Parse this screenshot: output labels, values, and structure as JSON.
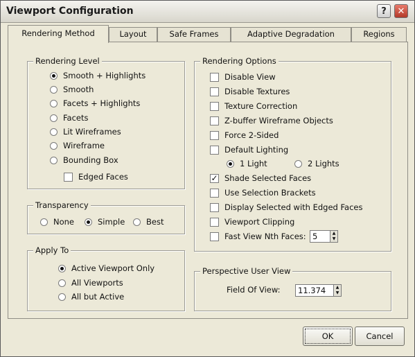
{
  "window": {
    "title": "Viewport Configuration",
    "help_label": "?",
    "close_label": "✕"
  },
  "tabs": [
    {
      "label": "Rendering Method"
    },
    {
      "label": "Layout"
    },
    {
      "label": "Safe Frames"
    },
    {
      "label": "Adaptive Degradation"
    },
    {
      "label": "Regions"
    }
  ],
  "rendering_level": {
    "legend": "Rendering Level",
    "options": [
      {
        "label": "Smooth + Highlights",
        "selected": true
      },
      {
        "label": "Smooth",
        "selected": false
      },
      {
        "label": "Facets + Highlights",
        "selected": false
      },
      {
        "label": "Facets",
        "selected": false
      },
      {
        "label": "Lit Wireframes",
        "selected": false
      },
      {
        "label": "Wireframe",
        "selected": false
      },
      {
        "label": "Bounding Box",
        "selected": false
      }
    ],
    "edged_faces": {
      "label": "Edged Faces",
      "checked": false
    }
  },
  "transparency": {
    "legend": "Transparency",
    "options": [
      {
        "label": "None",
        "selected": false
      },
      {
        "label": "Simple",
        "selected": true
      },
      {
        "label": "Best",
        "selected": false
      }
    ]
  },
  "apply_to": {
    "legend": "Apply To",
    "options": [
      {
        "label": "Active Viewport Only",
        "selected": true
      },
      {
        "label": "All Viewports",
        "selected": false
      },
      {
        "label": "All but Active",
        "selected": false
      }
    ]
  },
  "rendering_options": {
    "legend": "Rendering Options",
    "checks": [
      {
        "label": "Disable View",
        "checked": false
      },
      {
        "label": "Disable Textures",
        "checked": false
      },
      {
        "label": "Texture Correction",
        "checked": false
      },
      {
        "label": "Z-buffer Wireframe Objects",
        "checked": false
      },
      {
        "label": "Force 2-Sided",
        "checked": false
      },
      {
        "label": "Default Lighting",
        "checked": false
      }
    ],
    "lights": [
      {
        "label": "1 Light",
        "selected": true
      },
      {
        "label": "2 Lights",
        "selected": false
      }
    ],
    "checks2": [
      {
        "label": "Shade Selected Faces",
        "checked": true
      },
      {
        "label": "Use Selection Brackets",
        "checked": false
      },
      {
        "label": "Display Selected with Edged Faces",
        "checked": false
      },
      {
        "label": "Viewport Clipping",
        "checked": false
      },
      {
        "label": "Fast View Nth Faces:",
        "checked": false
      }
    ],
    "nth_faces_value": "5"
  },
  "perspective": {
    "legend": "Perspective User View",
    "fov_label": "Field Of View:",
    "fov_value": "11.374"
  },
  "buttons": {
    "ok": "OK",
    "cancel": "Cancel"
  }
}
